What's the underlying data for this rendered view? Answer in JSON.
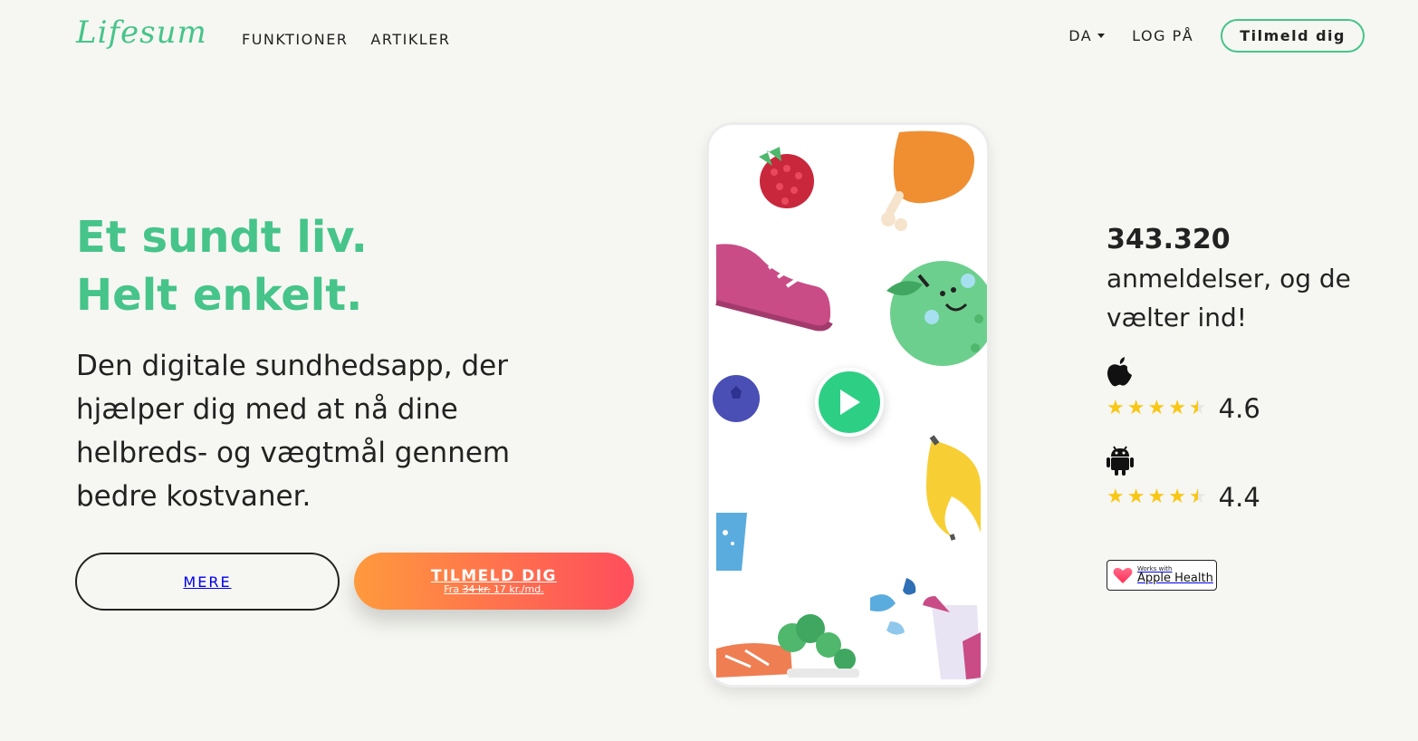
{
  "header": {
    "logo": "Lifesum",
    "nav": [
      "FUNKTIONER",
      "ARTIKLER"
    ],
    "language": "DA",
    "login": "LOG PÅ",
    "signup": "Tilmeld dig"
  },
  "hero": {
    "headline_1": "Et sundt liv.",
    "headline_2": "Helt enkelt.",
    "description": "Den digitale sundhedsapp, der hjælper dig med at nå dine helbreds- og vægtmål gennem bedre kostvaner.",
    "more_button": "MERE",
    "cta_title": "TILMELD DIG",
    "cta_prefix": "Fra",
    "cta_old_price": "34 kr.",
    "cta_new_price": "17 kr./md."
  },
  "reviews": {
    "count": "343.320",
    "text": "anmeldelser, og de vælter ind!",
    "ios_rating": "4.6",
    "android_rating": "4.4",
    "badge_small": "Works with",
    "badge_big": "Apple Health"
  },
  "colors": {
    "brand": "#46c48a",
    "cta_start": "#ff9a3d",
    "cta_end": "#ff4d5c",
    "star": "#f8c715"
  },
  "icons": [
    "apple-icon",
    "android-icon",
    "heart-icon",
    "play-icon",
    "caret-down-icon"
  ]
}
